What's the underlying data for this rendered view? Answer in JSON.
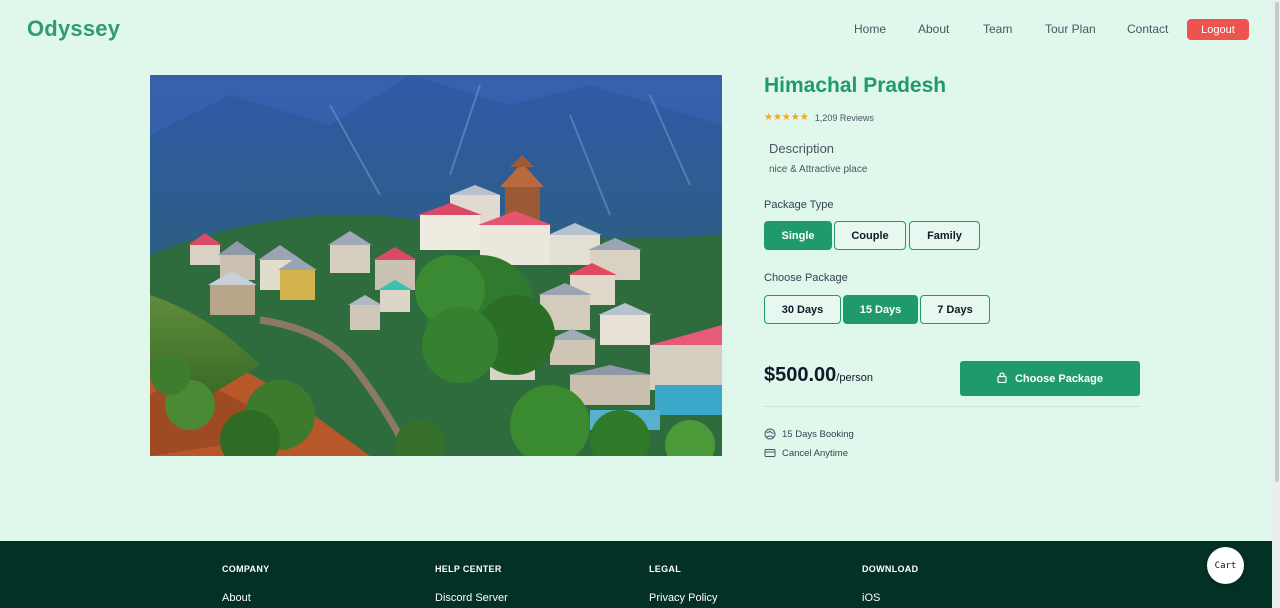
{
  "brand": "Odyssey",
  "nav": {
    "links": [
      "Home",
      "About",
      "Team",
      "Tour Plan",
      "Contact"
    ],
    "logout": "Logout"
  },
  "hero_image": {
    "alt_icon": "mountain-village-photo"
  },
  "destination": {
    "title": "Himachal Pradesh",
    "stars": "★★★★★",
    "reviews": "1,209 Reviews",
    "description_heading": "Description",
    "description": "nice & Attractive place"
  },
  "package_type": {
    "label": "Package Type",
    "options": [
      "Single",
      "Couple",
      "Family"
    ],
    "selected": "Single"
  },
  "duration": {
    "label": "Choose Package",
    "options": [
      "30 Days",
      "15 Days",
      "7 Days"
    ],
    "selected": "15 Days"
  },
  "pricing": {
    "amount": "$500.00",
    "unit": "/person",
    "cta": "Choose Package",
    "cta_icon": "lock-icon"
  },
  "features": [
    {
      "icon": "globe-icon",
      "text": "15 Days Booking"
    },
    {
      "icon": "card-icon",
      "text": "Cancel Anytime"
    }
  ],
  "footer": {
    "columns": [
      {
        "heading": "COMPANY",
        "first_link": "About"
      },
      {
        "heading": "HELP CENTER",
        "first_link": "Discord Server"
      },
      {
        "heading": "LEGAL",
        "first_link": "Privacy Policy"
      },
      {
        "heading": "DOWNLOAD",
        "first_link": "iOS"
      }
    ]
  },
  "cart": "Cart",
  "colors": {
    "background": "#e0f7ec",
    "accent": "#1f9a6a",
    "logout": "#ef5350",
    "footer": "#043125",
    "stars": "#f4a61c"
  }
}
